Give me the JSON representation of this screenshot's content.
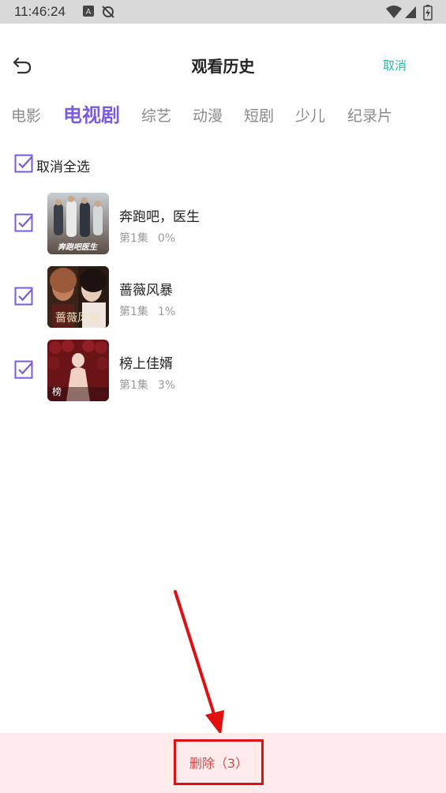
{
  "status_bar": {
    "time": "11:46:24"
  },
  "header": {
    "title": "观看历史",
    "cancel_label": "取消"
  },
  "tabs": [
    {
      "label": "电影",
      "active": false
    },
    {
      "label": "电视剧",
      "active": true
    },
    {
      "label": "综艺",
      "active": false
    },
    {
      "label": "动漫",
      "active": false
    },
    {
      "label": "短剧",
      "active": false
    },
    {
      "label": "少儿",
      "active": false
    },
    {
      "label": "纪录片",
      "active": false
    }
  ],
  "select_all": {
    "label": "取消全选",
    "checked": true
  },
  "items": [
    {
      "title": "奔跑吧，医生",
      "episode": "第1集",
      "progress": "0%",
      "checked": true,
      "poster_text": "奔跑吧医生"
    },
    {
      "title": "蔷薇风暴",
      "episode": "第1集",
      "progress": "1%",
      "checked": true,
      "poster_text": "蔷薇风暴"
    },
    {
      "title": "榜上佳婿",
      "episode": "第1集",
      "progress": "3%",
      "checked": true,
      "poster_text": "榜"
    }
  ],
  "footer": {
    "delete_label": "删除（3）"
  },
  "colors": {
    "accent": "#7a5be0",
    "cancel": "#2bb8a4",
    "delete_text": "#e04848",
    "footer_bg": "#fdeceb",
    "annotation": "#e01010"
  }
}
